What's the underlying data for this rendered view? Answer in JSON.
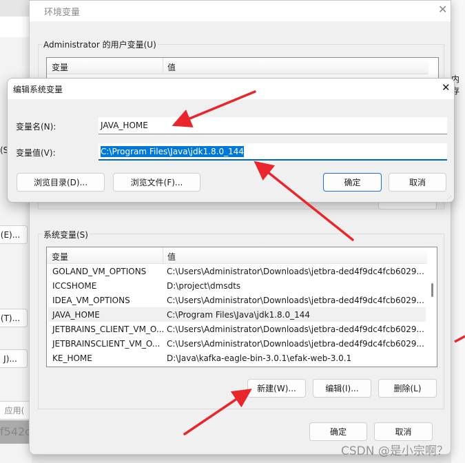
{
  "background": {
    "left_fragments": [
      "(S)",
      "(E)...",
      "(T)...",
      "J)...",
      "应用(",
      "f542c"
    ],
    "right_fragment": "内存"
  },
  "env_window": {
    "title": "环境变量",
    "user_group_label": "Administrator 的用户变量(U)",
    "user_columns": [
      "变量",
      "值"
    ],
    "system_group_label": "系统变量(S)",
    "system_columns": [
      "变量",
      "值"
    ],
    "system_rows": [
      {
        "name": "GOLAND_VM_OPTIONS",
        "value": "C:\\Users\\Administrator\\Downloads\\jetbra-ded4f9dc4fcb6029..."
      },
      {
        "name": "ICCSHOME",
        "value": "D:\\project\\dmsdts"
      },
      {
        "name": "IDEA_VM_OPTIONS",
        "value": "C:\\Users\\Administrator\\Downloads\\jetbra-ded4f9dc4fcb6029..."
      },
      {
        "name": "JAVA_HOME",
        "value": "C:\\Program Files\\Java\\jdk1.8.0_144"
      },
      {
        "name": "JETBRAINS_CLIENT_VM_O...",
        "value": "C:\\Users\\Administrator\\Downloads\\jetbra-ded4f9dc4fcb6029..."
      },
      {
        "name": "JETBRAINSCLIENT_VM_O...",
        "value": "C:\\Users\\Administrator\\Downloads\\jetbra-ded4f9dc4fcb6029..."
      },
      {
        "name": "KE_HOME",
        "value": "D:\\Java\\kafka-eagle-bin-3.0.1\\efak-web-3.0.1"
      }
    ],
    "selected_row": "JAVA_HOME",
    "new_button": "新建(W)...",
    "edit_button": "编辑(I)...",
    "delete_button": "删除(L)",
    "ok_button": "确定",
    "cancel_button": "取消"
  },
  "edit_dialog": {
    "title": "编辑系统变量",
    "name_label": "变量名(N):",
    "name_value": "JAVA_HOME",
    "value_label": "变量值(V):",
    "value_value": "C:\\Program Files\\Java\\jdk1.8.0_144",
    "browse_dir_button": "浏览目录(D)...",
    "browse_file_button": "浏览文件(F)...",
    "ok_button": "确定",
    "cancel_button": "取消"
  },
  "watermark": "CSDN @是小宗啊？",
  "colors": {
    "accent": "#0078d7",
    "annotation_arrow": "#e8262b"
  }
}
